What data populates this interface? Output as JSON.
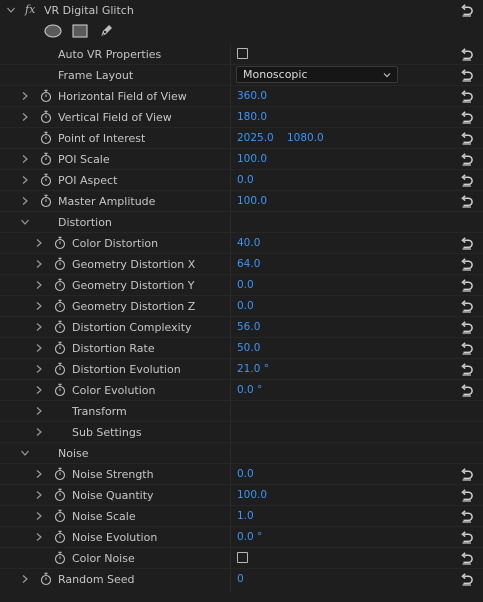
{
  "effect": {
    "fx_label": "fx",
    "name": "VR Digital Glitch"
  },
  "auto_vr": {
    "label": "Auto VR Properties",
    "checked": false
  },
  "frame_layout": {
    "label": "Frame Layout",
    "value": "Monoscopic"
  },
  "params": {
    "hfov": {
      "label": "Horizontal Field of View",
      "value": "360.0"
    },
    "vfov": {
      "label": "Vertical Field of View",
      "value": "180.0"
    },
    "poi": {
      "label": "Point of Interest",
      "x": "2025.0",
      "y": "1080.0"
    },
    "poi_scale": {
      "label": "POI Scale",
      "value": "100.0"
    },
    "poi_aspect": {
      "label": "POI Aspect",
      "value": "0.0"
    },
    "master_amp": {
      "label": "Master Amplitude",
      "value": "100.0"
    }
  },
  "distortion": {
    "label": "Distortion",
    "items": {
      "color_distortion": {
        "label": "Color Distortion",
        "value": "40.0"
      },
      "geo_x": {
        "label": "Geometry Distortion X",
        "value": "64.0"
      },
      "geo_y": {
        "label": "Geometry Distortion Y",
        "value": "0.0"
      },
      "geo_z": {
        "label": "Geometry Distortion Z",
        "value": "0.0"
      },
      "complexity": {
        "label": "Distortion Complexity",
        "value": "56.0"
      },
      "rate": {
        "label": "Distortion Rate",
        "value": "50.0"
      },
      "evolution": {
        "label": "Distortion Evolution",
        "value": "21.0 °"
      },
      "color_evolution": {
        "label": "Color Evolution",
        "value": "0.0 °"
      }
    },
    "transform_label": "Transform",
    "sub_settings_label": "Sub Settings"
  },
  "noise": {
    "label": "Noise",
    "items": {
      "strength": {
        "label": "Noise Strength",
        "value": "0.0"
      },
      "quantity": {
        "label": "Noise Quantity",
        "value": "100.0"
      },
      "scale": {
        "label": "Noise Scale",
        "value": "1.0"
      },
      "evolution": {
        "label": "Noise Evolution",
        "value": "0.0 °"
      },
      "color_noise": {
        "label": "Color Noise",
        "checked": false
      }
    }
  },
  "random_seed": {
    "label": "Random Seed",
    "value": "0"
  },
  "colors": {
    "value_blue": "#3d95f5",
    "background": "#1e1e1e",
    "text": "#c6c6c6"
  },
  "icons": [
    "twirl-down-icon",
    "twirl-right-icon",
    "stopwatch-icon",
    "reset-icon",
    "ellipse-mask-icon",
    "rectangle-mask-icon",
    "pen-mask-icon",
    "chevron-down-icon"
  ]
}
